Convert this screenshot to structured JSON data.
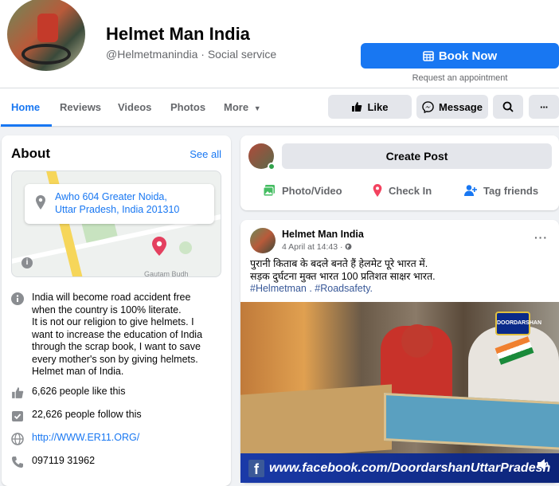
{
  "page": {
    "name": "Helmet Man India",
    "handle": "@Helmetmanindia",
    "separator": "·",
    "category": "Social service"
  },
  "cta": {
    "button_label": "Book Now",
    "caption": "Request an appointment",
    "icon": "calendar-icon"
  },
  "nav": {
    "tabs": [
      {
        "label": "Home",
        "active": true
      },
      {
        "label": "Reviews",
        "active": false
      },
      {
        "label": "Videos",
        "active": false
      },
      {
        "label": "Photos",
        "active": false
      },
      {
        "label": "More",
        "active": false
      }
    ],
    "like_label": "Like",
    "message_label": "Message",
    "more_label": "···"
  },
  "about": {
    "title": "About",
    "see_all": "See all",
    "address_line1": "Awho 604 Greater Noida,",
    "address_line2": "Uttar Pradesh, India 201310",
    "map_place_label": "Gautam Budh",
    "description": [
      "India will become road accident free",
      "when the country is 100% literate.",
      "It is not our religion to give helmets. I",
      "want to increase the education of India",
      "through the scrap book, I want to save",
      "every mother's son by giving helmets.",
      "Helmet man of India."
    ],
    "likes": "6,626 people like this",
    "follows": "22,626 people follow this",
    "website": "http://WWW.ER11.ORG/",
    "phone": "097119 31962"
  },
  "create_post": {
    "button_label": "Create Post",
    "actions": [
      "Photo/Video",
      "Check In",
      "Tag friends"
    ]
  },
  "post": {
    "author": "Helmet Man India",
    "timestamp": "4 April at 14:43 ·",
    "more": "···",
    "text_line1": "पुरानी किताब के बदले बनते हैं हेलमेट पूरे भारत में.",
    "text_line2": "सड़क दुर्घटना मुक्त भारत 100 प्रतिशत साक्षर भारत.",
    "tags": "#Helmetman . #Roadsafety.",
    "video_banner": "www.facebook.com/DoordarshanUttarPradesh",
    "channel_logo": "DOORDARSHAN",
    "fb_badge": "f"
  },
  "colors": {
    "accent": "#1877f2",
    "background": "#f0f2f5",
    "secondary_text": "#65676b",
    "button_gray": "#e4e6eb"
  }
}
